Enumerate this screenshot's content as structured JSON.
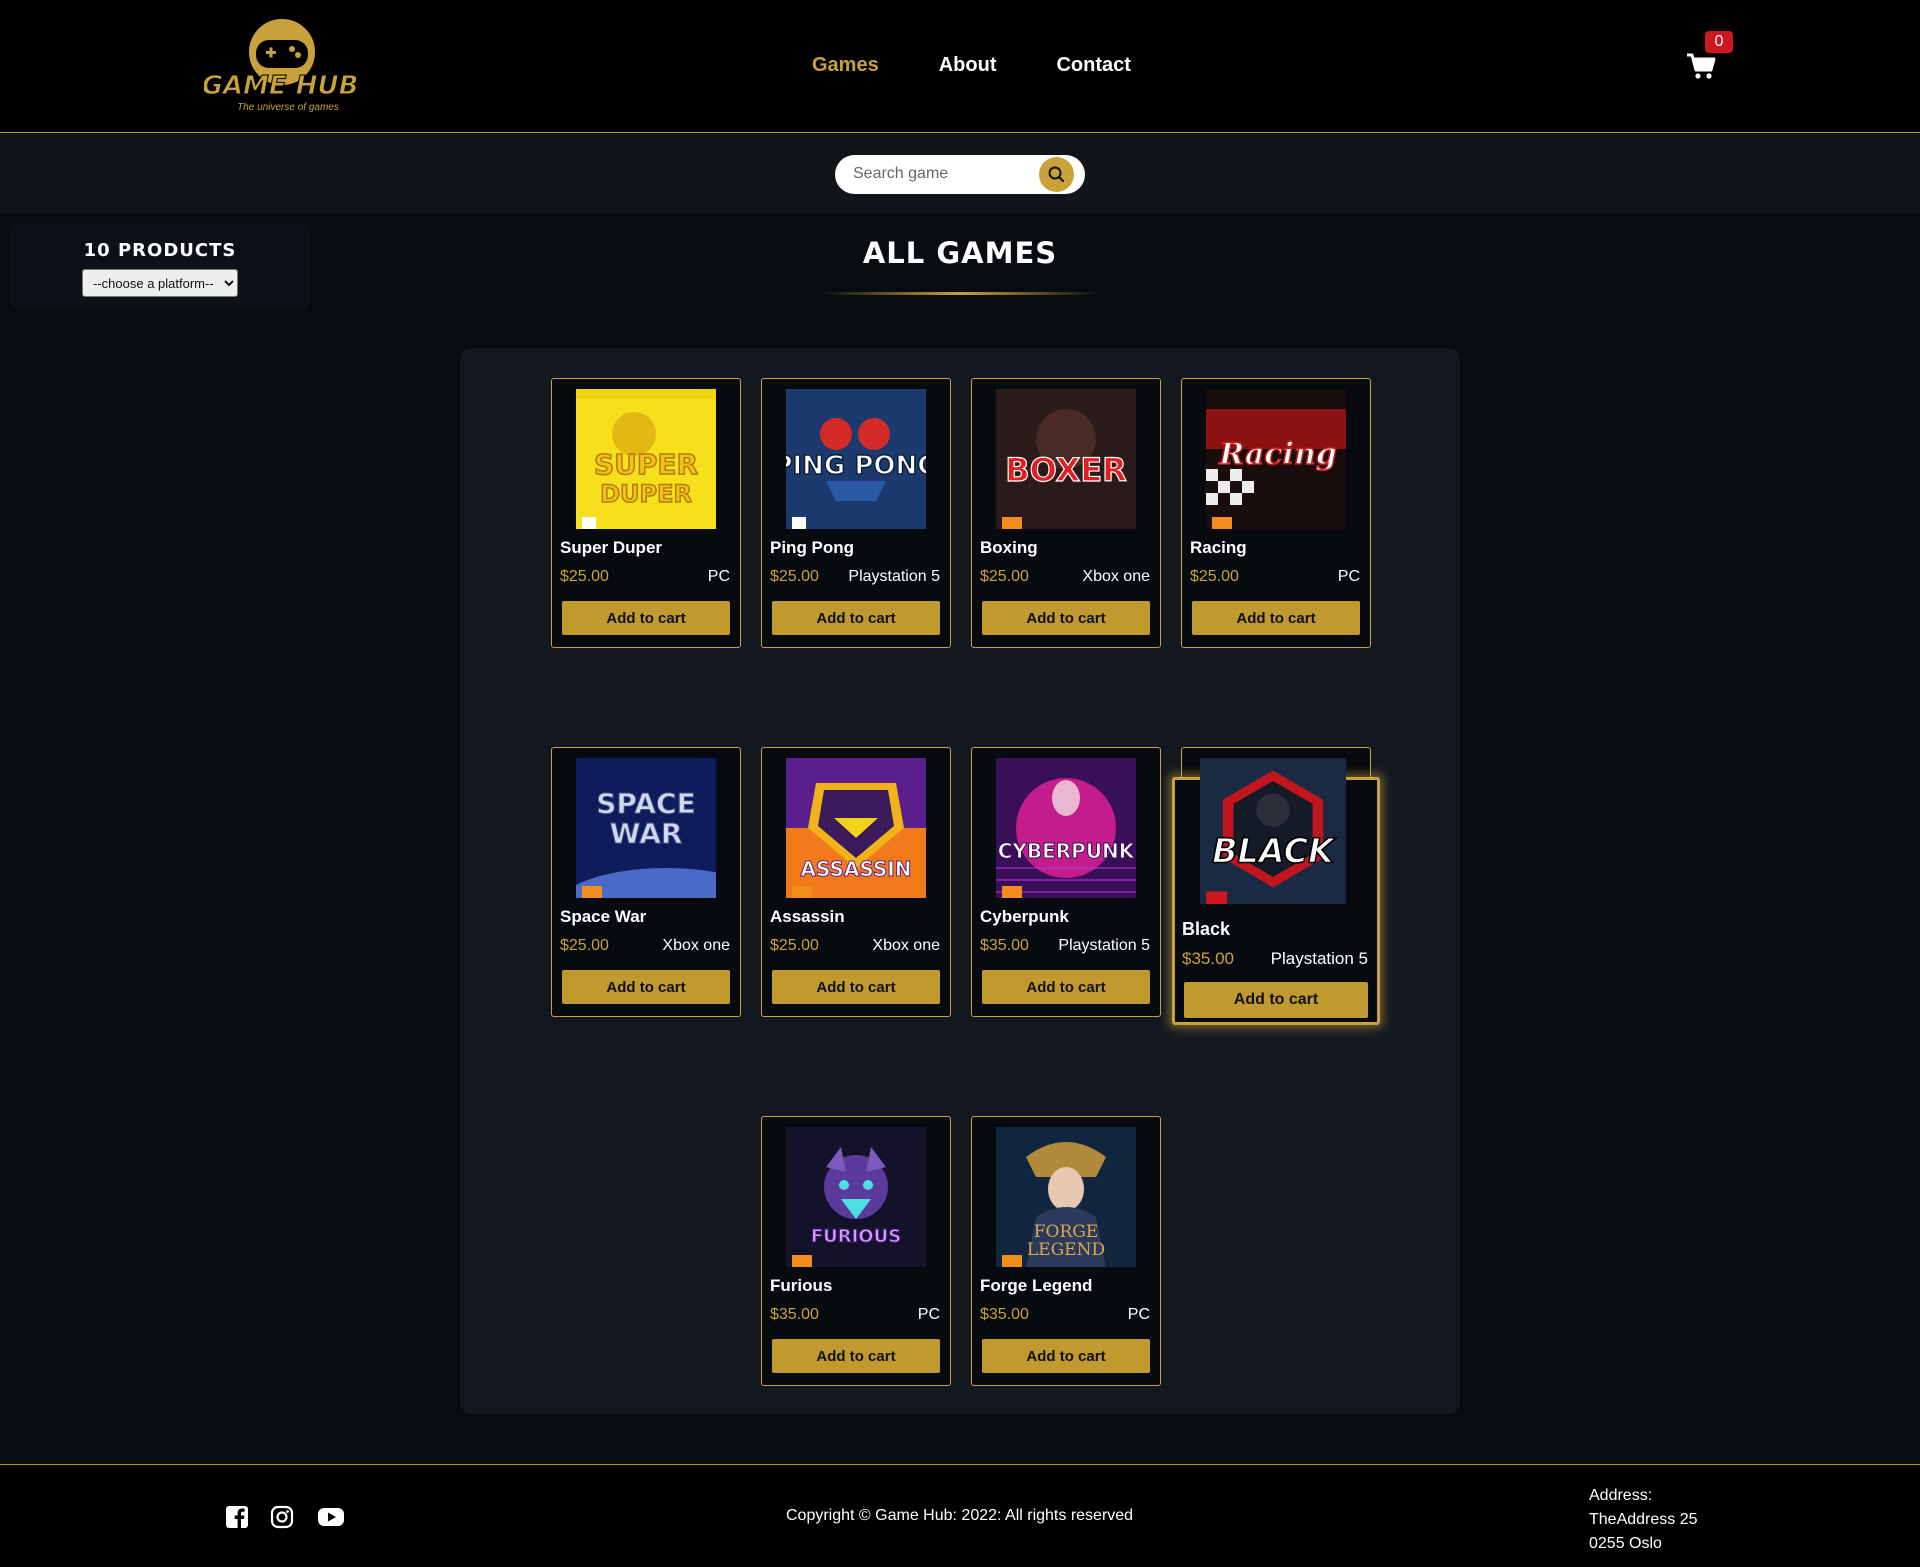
{
  "header": {
    "logo_text": "GAME HUB",
    "logo_tagline": "The universe of games",
    "nav": [
      {
        "label": "Games",
        "active": true
      },
      {
        "label": "About",
        "active": false
      },
      {
        "label": "Contact",
        "active": false
      }
    ],
    "cart_count": "0"
  },
  "search": {
    "placeholder": "Search game"
  },
  "filter": {
    "product_count_label": "10 PRODUCTS",
    "platform_select": "--choose a platform--"
  },
  "main": {
    "title": "ALL GAMES"
  },
  "products": [
    {
      "name": "Super Duper",
      "price": "$25.00",
      "platform": "PC",
      "cover_text": "SUPER DUPER",
      "button": "Add to cart"
    },
    {
      "name": "Ping Pong",
      "price": "$25.00",
      "platform": "Playstation 5",
      "cover_text": "PING PONG",
      "button": "Add to cart"
    },
    {
      "name": "Boxing",
      "price": "$25.00",
      "platform": "Xbox one",
      "cover_text": "BOXER",
      "button": "Add to cart"
    },
    {
      "name": "Racing",
      "price": "$25.00",
      "platform": "PC",
      "cover_text": "Racing",
      "button": "Add to cart"
    },
    {
      "name": "Space War",
      "price": "$25.00",
      "platform": "Xbox one",
      "cover_text": "SPACE WAR",
      "button": "Add to cart"
    },
    {
      "name": "Assassin",
      "price": "$25.00",
      "platform": "Xbox one",
      "cover_text": "ASSASSIN",
      "button": "Add to cart"
    },
    {
      "name": "Cyberpunk",
      "price": "$35.00",
      "platform": "Playstation 5",
      "cover_text": "CYBERPUNK",
      "button": "Add to cart"
    },
    {
      "name": "Black",
      "price": "$35.00",
      "platform": "Playstation 5",
      "cover_text": "BLACK",
      "button": "Add to cart"
    },
    {
      "name": "Furious",
      "price": "$35.00",
      "platform": "PC",
      "cover_text": "FURIOUS",
      "button": "Add to cart"
    },
    {
      "name": "Forge Legend",
      "price": "$35.00",
      "platform": "PC",
      "cover_text": "FORGE LEGEND",
      "button": "Add to cart"
    }
  ],
  "footer": {
    "copyright": "Copyright © Game Hub: 2022: All rights reserved",
    "address_label": "Address:",
    "address_line1": "TheAddress 25",
    "address_line2": "0255 Oslo",
    "social_icons": [
      "facebook-icon",
      "instagram-icon",
      "youtube-icon"
    ]
  },
  "colors": {
    "accent": "#c9a23c",
    "background": "#000000",
    "panel": "#131820",
    "badge": "#d0161e"
  }
}
